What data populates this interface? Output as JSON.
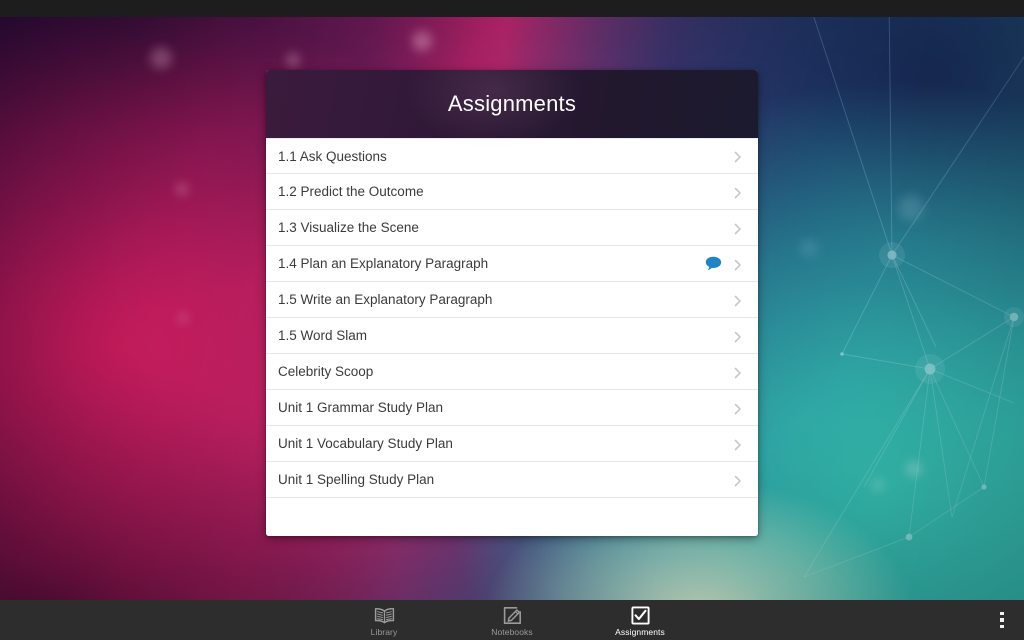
{
  "window": {
    "statusbar_present": true
  },
  "card": {
    "title": "Assignments",
    "rows": [
      {
        "label": "1.1 Ask Questions",
        "badge": null,
        "chevron": "chevron-right-icon"
      },
      {
        "label": "1.2 Predict the Outcome",
        "badge": null,
        "chevron": "chevron-right-icon"
      },
      {
        "label": "1.3 Visualize the Scene",
        "badge": null,
        "chevron": "chevron-right-icon"
      },
      {
        "label": "1.4 Plan an Explanatory Paragraph",
        "badge": "comment-bubble-icon",
        "chevron": "chevron-right-icon"
      },
      {
        "label": "1.5 Write an Explanatory Paragraph",
        "badge": null,
        "chevron": "chevron-right-icon"
      },
      {
        "label": "1.5 Word Slam",
        "badge": null,
        "chevron": "chevron-right-icon"
      },
      {
        "label": "Celebrity Scoop",
        "badge": null,
        "chevron": "chevron-right-icon"
      },
      {
        "label": "Unit 1 Grammar Study Plan",
        "badge": null,
        "chevron": "chevron-right-icon"
      },
      {
        "label": "Unit 1 Vocabulary Study Plan",
        "badge": null,
        "chevron": "chevron-right-icon"
      },
      {
        "label": "Unit 1 Spelling Study Plan",
        "badge": null,
        "chevron": "chevron-right-icon"
      }
    ]
  },
  "navbar": {
    "tabs": [
      {
        "label": "Library",
        "icon": "open-book-icon",
        "active": false
      },
      {
        "label": "Notebooks",
        "icon": "pencil-square-icon",
        "active": false
      },
      {
        "label": "Assignments",
        "icon": "checkbox-check-icon",
        "active": true
      }
    ],
    "overflow_menu": "more-vert-icon"
  },
  "colors": {
    "badge_blue": "#1f83c4",
    "chevron_gray": "#c8c8c8",
    "card_background": "#ffffff",
    "header_dark": "#2a1733",
    "navbar": "#2d2d2d",
    "active_tab_text": "#ffffff",
    "inactive_tab_text": "#9a9a9a"
  }
}
